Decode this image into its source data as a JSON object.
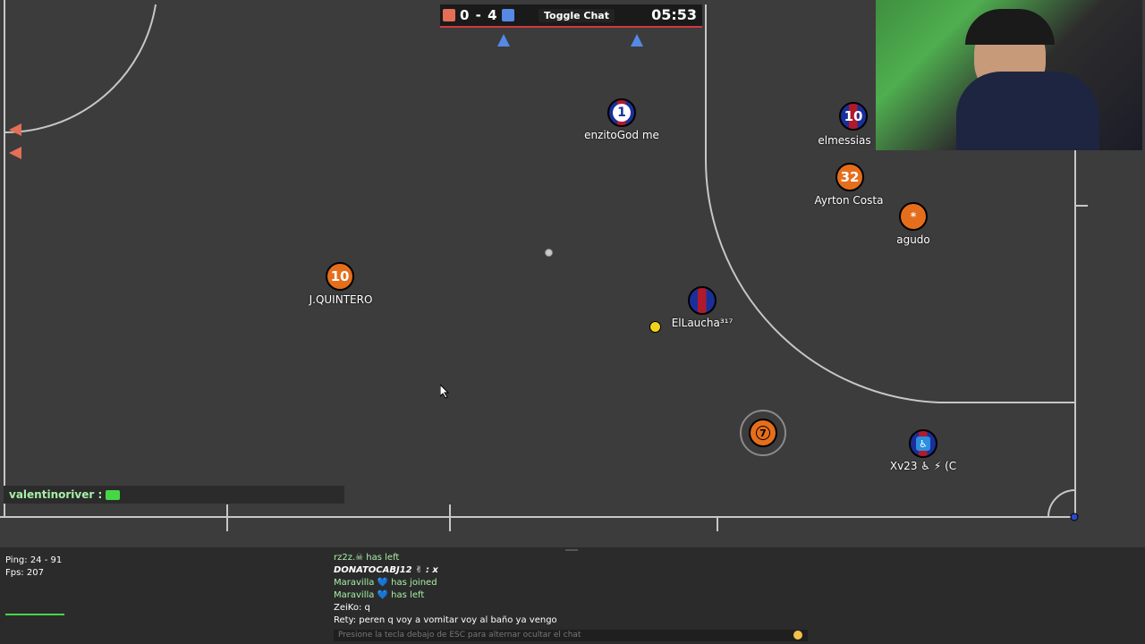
{
  "scoreboard": {
    "score": "0 - 4",
    "toggle_chat_label": "Toggle Chat",
    "time": "05:53",
    "red_color": "#e56e56",
    "blue_color": "#5689e5"
  },
  "players": [
    {
      "number": "1",
      "name": "enzitoGod me",
      "team": "blue"
    },
    {
      "number": "10",
      "name": "elmessias",
      "team": "blue"
    },
    {
      "number": "32",
      "name": "Ayrton Costa",
      "team": "red"
    },
    {
      "number": "*",
      "name": "agudo",
      "team": "red"
    },
    {
      "number": "10",
      "name": "J.QUINTERO",
      "team": "red"
    },
    {
      "number": "",
      "name": "ElLaucha³¹⁷",
      "team": "blue"
    },
    {
      "number": "7",
      "name": "",
      "team": "red"
    },
    {
      "number": "♿",
      "name": "Xv23 ♿ ⚡ (C",
      "team": "blue"
    }
  ],
  "overlay_chat": "valentinoriver : ",
  "stats": {
    "ping": "Ping: 24 - 91",
    "fps": "Fps: 207"
  },
  "chat": {
    "lines": [
      {
        "text": "rz2z.☠ has left",
        "style": "g"
      },
      {
        "text": "DONATOCABJ12 ✌ : x",
        "style": "b"
      },
      {
        "text": "Maravilla 💙 has joined",
        "style": "g"
      },
      {
        "text": "Maravilla 💙 has left",
        "style": "g"
      },
      {
        "text": "ZeiKo: q",
        "style": ""
      },
      {
        "text": "Rety: peren q voy a vomitar voy al baño ya vengo",
        "style": ""
      }
    ],
    "input_placeholder": "Presione la tecla debajo de ESC para alternar ocultar el chat"
  }
}
